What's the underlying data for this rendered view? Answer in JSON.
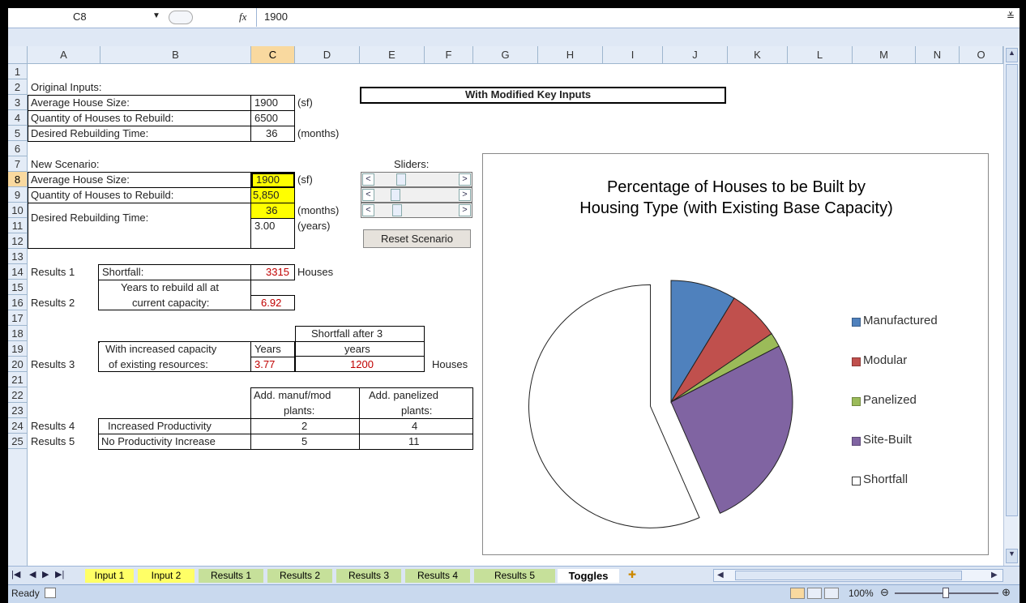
{
  "formula_bar": {
    "name_box": "C8",
    "fx": "fx",
    "value": "1900"
  },
  "columns": [
    "A",
    "B",
    "C",
    "D",
    "E",
    "F",
    "G",
    "H",
    "I",
    "J",
    "K",
    "L",
    "M",
    "N",
    "O"
  ],
  "rows": [
    "1",
    "2",
    "3",
    "4",
    "5",
    "6",
    "7",
    "8",
    "9",
    "10",
    "11",
    "12",
    "13",
    "14",
    "15",
    "16",
    "17",
    "18",
    "19",
    "20",
    "21",
    "22",
    "23",
    "24",
    "25"
  ],
  "cells": {
    "a2": "Original Inputs:",
    "a3": "Average House Size:",
    "c3": "1900",
    "d3": "(sf)",
    "a4": "Quantity of Houses to Rebuild:",
    "c4": "6500",
    "a5": "Desired Rebuilding Time:",
    "c5": "36",
    "d5": "(months)",
    "e2": "With Modified Key Inputs",
    "a7": "New Scenario:",
    "e7": "Sliders:",
    "a8": "Average House Size:",
    "c8": "1900",
    "d8": "(sf)",
    "a9": "Quantity of Houses to Rebuild:",
    "c9": "5,850",
    "a10": "Desired Rebuilding Time:",
    "c10": "36",
    "d10": "(months)",
    "c11": "3.00",
    "d11": "(years)",
    "reset": "Reset Scenario",
    "a13": "Results 1",
    "b13": "Shortfall:",
    "c13": "3315",
    "d13": "Houses",
    "b15": "Years to rebuild all at",
    "b16": "current capacity:",
    "a16": "Results 2",
    "c16": "6.92",
    "e18": "Shortfall after 3",
    "e19": "years",
    "b19": "With increased capacity",
    "b20": "of existing resources:",
    "c19": "Years",
    "a20": "Results 3",
    "c20": "3.77",
    "e20": "1200",
    "f20": "Houses",
    "c22": "Add. manuf/mod",
    "c23": "plants:",
    "e22": "Add. panelized",
    "e23": "plants:",
    "a24": "Results 4",
    "b24": "Increased Productivity",
    "c24": "2",
    "e24": "4",
    "a25": "Results 5",
    "b25": "No Productivity Increase",
    "c25": "5",
    "e25": "11"
  },
  "chart": {
    "title_line1": "Percentage of Houses to be Built by",
    "title_line2": "Housing Type (with Existing Base Capacity)",
    "legend": [
      "Manufactured",
      "Modular",
      "Panelized",
      "Site-Built",
      "Shortfall"
    ],
    "colors": [
      "#4f81bd",
      "#c0504d",
      "#9bbb59",
      "#8064a2",
      "#ffffff"
    ]
  },
  "chart_data": {
    "type": "pie",
    "title": "Percentage of Houses to be Built by Housing Type (with Existing Base Capacity)",
    "categories": [
      "Manufactured",
      "Modular",
      "Panelized",
      "Site-Built",
      "Shortfall"
    ],
    "values": [
      8.7,
      6.8,
      1.9,
      26.0,
      56.6
    ],
    "exploded": [
      "Shortfall"
    ],
    "legend_position": "right"
  },
  "tabs": [
    "Input 1",
    "Input 2",
    "Results 1",
    "Results 2",
    "Results 3",
    "Results 4",
    "Results 5",
    "Toggles"
  ],
  "status": {
    "ready": "Ready",
    "zoom": "100%"
  }
}
